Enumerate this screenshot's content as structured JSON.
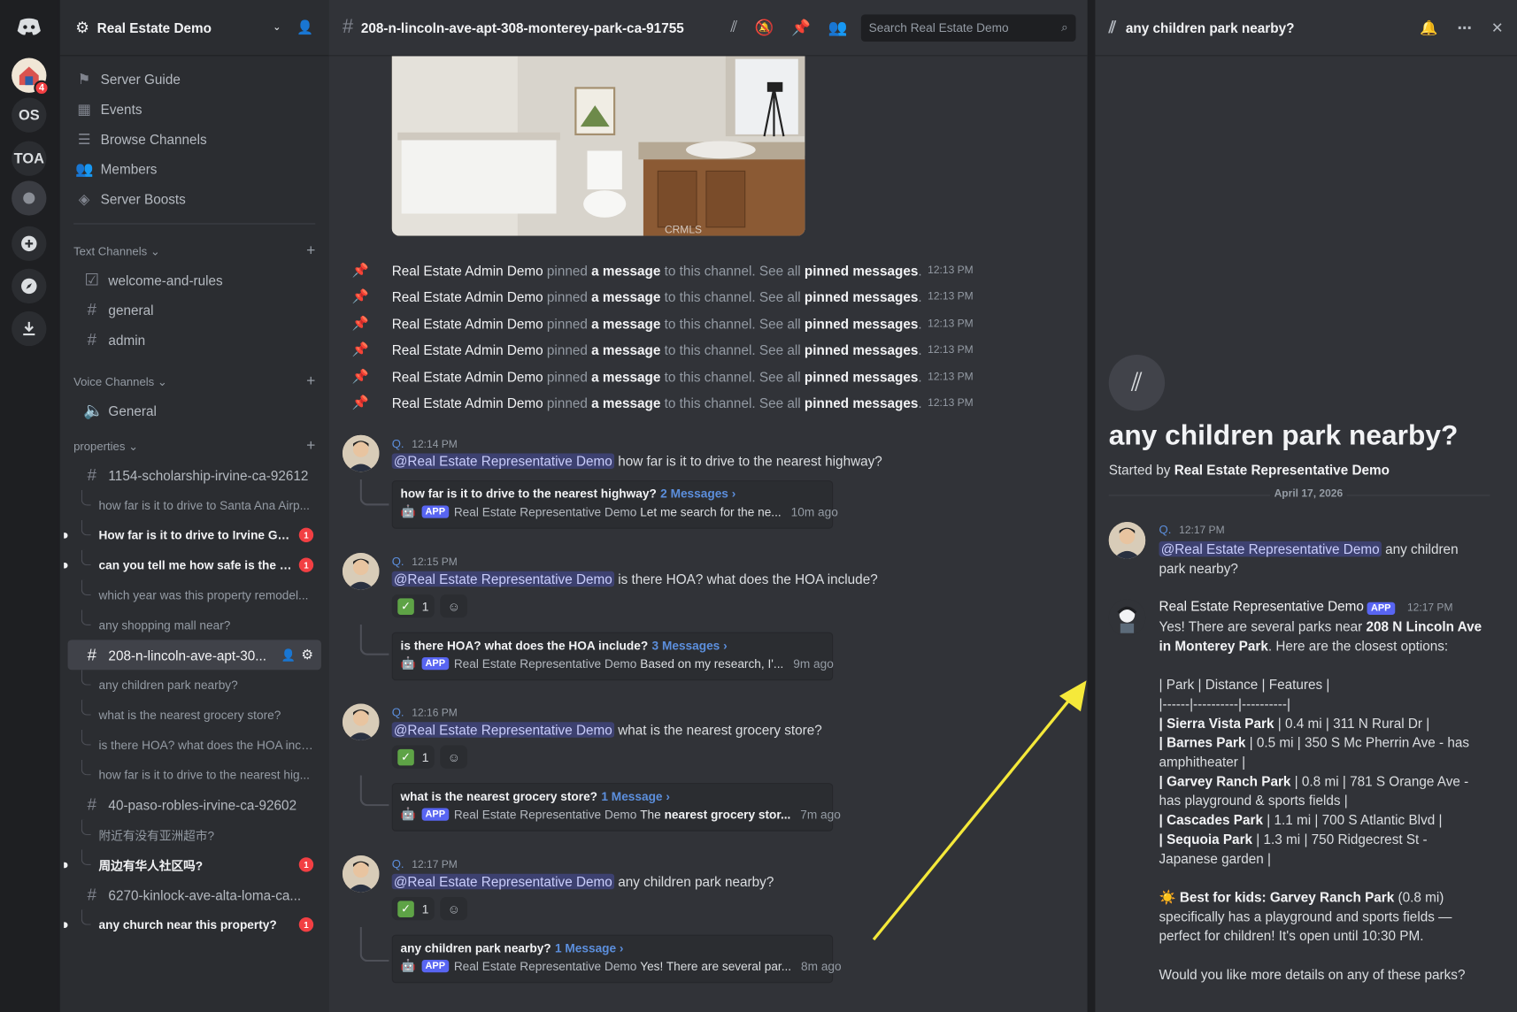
{
  "server": {
    "name": "Real Estate Demo",
    "rail": [
      {
        "label": "",
        "icon": "discord-logo-icon"
      },
      {
        "label": "",
        "icon": "house-server-icon",
        "badge": "4"
      },
      {
        "label": "OS"
      },
      {
        "label": "TOA"
      },
      {
        "label": "",
        "icon": "server-avatar-icon"
      },
      {
        "label": "",
        "icon": "add-server-icon"
      },
      {
        "label": "",
        "icon": "explore-icon"
      },
      {
        "label": "",
        "icon": "download-icon"
      }
    ]
  },
  "nav": {
    "server_guide": "Server Guide",
    "events": "Events",
    "browse_channels": "Browse Channels",
    "members": "Members",
    "server_boosts": "Server Boosts"
  },
  "sections": {
    "text": "Text Channels",
    "voice": "Voice Channels",
    "properties": "properties"
  },
  "text_channels": [
    "welcome-and-rules",
    "general",
    "admin"
  ],
  "voice_channels": [
    "General"
  ],
  "properties": {
    "p1": {
      "name": "1154-scholarship-irvine-ca-92612",
      "threads": [
        {
          "label": "how far is it to drive to Santa Ana Airp..."
        },
        {
          "label": "How far is it to drive to Irvine Grea...",
          "badge": "1"
        },
        {
          "label": "can you tell me how safe is the nei...",
          "badge": "1"
        },
        {
          "label": "which year was this property remodel..."
        },
        {
          "label": "any shopping mall near?"
        }
      ]
    },
    "p2": {
      "name": "208-n-lincoln-ave-apt-30...",
      "threads": [
        {
          "label": "any children park nearby?"
        },
        {
          "label": "what is the nearest grocery store?"
        },
        {
          "label": "is there HOA? what does the HOA incl..."
        },
        {
          "label": "how far is it to drive to the nearest hig..."
        }
      ]
    },
    "p3": {
      "name": "40-paso-robles-irvine-ca-92602",
      "threads": [
        {
          "label": "附近有没有亚洲超市?"
        },
        {
          "label": "周边有华人社区吗?",
          "badge": "1"
        }
      ]
    },
    "p4": {
      "name": "6270-kinlock-ave-alta-loma-ca...",
      "threads": [
        {
          "label": "any church near this property?",
          "badge": "1"
        }
      ]
    }
  },
  "main": {
    "channel_title": "208-n-lincoln-ave-apt-308-monterey-park-ca-91755",
    "search_placeholder": "Search Real Estate Demo",
    "photo_watermark": "CRMLS",
    "pin_notice": {
      "user": "Real Estate Admin Demo",
      "verb": "pinned",
      "a_message": "a message",
      "middle": "to this channel. See all",
      "pinned_messages": "pinned messages",
      "dot": ".",
      "time": "12:13 PM"
    },
    "messages": [
      {
        "author": "Q.",
        "time": "12:14 PM",
        "mention": "@Real Estate Representative Demo",
        "text": "how far is it to drive to the nearest highway?",
        "thread": {
          "title": "how far is it to drive to the nearest highway?",
          "count": "2 Messages ›",
          "tag": "APP",
          "bot": "Real Estate Representative Demo",
          "preview": "Let me search for the ne...",
          "ago": "10m ago"
        }
      },
      {
        "author": "Q.",
        "time": "12:15 PM",
        "mention": "@Real Estate Representative Demo",
        "text": "is there HOA? what does the HOA include?",
        "reaction": "1",
        "thread": {
          "title": "is there HOA? what does the HOA include?",
          "count": "3 Messages ›",
          "tag": "APP",
          "bot": "Real Estate Representative Demo",
          "preview": "Based on my research, I'...",
          "ago": "9m ago"
        }
      },
      {
        "author": "Q.",
        "time": "12:16 PM",
        "mention": "@Real Estate Representative Demo",
        "text": "what is the nearest grocery store?",
        "reaction": "1",
        "thread": {
          "title": "what is the nearest grocery store?",
          "count": "1 Message ›",
          "tag": "APP",
          "bot": "Real Estate Representative Demo",
          "preview_pre": "The",
          "preview_bold": "nearest grocery stor...",
          "ago": "7m ago"
        }
      },
      {
        "author": "Q.",
        "time": "12:17 PM",
        "mention": "@Real Estate Representative Demo",
        "text": "any children park nearby?",
        "reaction": "1",
        "thread": {
          "title": "any children park nearby?",
          "count": "1 Message ›",
          "tag": "APP",
          "bot": "Real Estate Representative Demo",
          "preview": "Yes! There are several par...",
          "ago": "8m ago"
        }
      }
    ]
  },
  "panel": {
    "title": "any children park nearby?",
    "hero_title": "any children park nearby?",
    "started_by_prefix": "Started by",
    "started_by": "Real Estate Representative Demo",
    "date": "April 17, 2026",
    "q_author": "Q.",
    "q_time": "12:17 PM",
    "q_mention": "@Real Estate Representative Demo",
    "q_text": "any children park nearby?",
    "bot_name": "Real Estate Representative Demo",
    "bot_tag": "APP",
    "bot_time": "12:17 PM",
    "intro_pre": "Yes! There are several parks near",
    "intro_bold": "208 N Lincoln Ave in Monterey Park",
    "intro_post": ". Here are the closest options:",
    "table_header": "| Park | Distance | Features |",
    "table_sep": "|------|----------|----------|",
    "rows": [
      {
        "name": "Sierra Vista Park",
        "rest": "| 0.4 mi | 311 N Rural Dr |"
      },
      {
        "name": "Barnes Park",
        "rest": "| 0.5 mi | 350 S Mc Pherrin Ave - has amphitheater |"
      },
      {
        "name": "Garvey Ranch Park",
        "rest": "| 0.8 mi | 781 S Orange Ave - has playground & sports fields |"
      },
      {
        "name": "Cascades Park",
        "rest": "| 1.1 mi | 700 S Atlantic Blvd |"
      },
      {
        "name": "Sequoia Park",
        "rest": "| 1.3 mi | 750 Ridgecrest St - Japanese garden |"
      }
    ],
    "best_emoji": "☀️",
    "best_bold": "Best for kids: Garvey Ranch Park",
    "best_rest": "(0.8 mi) specifically has a playground and sports fields — perfect for children! It's open until 10:30 PM.",
    "closing": "Would you like more details on any of these parks?"
  },
  "colors": {
    "accent": "#5865f2",
    "mention_link": "#5c8fdd",
    "unread_badge": "#f23f43",
    "annotation_arrow": "#f5e93a"
  }
}
